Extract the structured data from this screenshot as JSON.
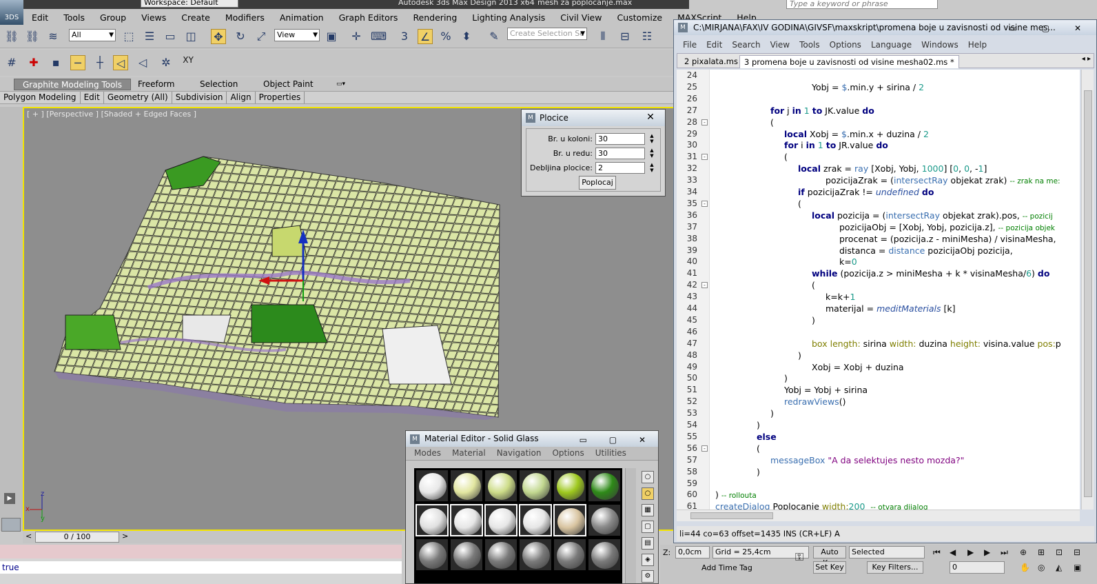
{
  "titlebar": {
    "app_logo": "3DS",
    "workspace": "Workspace: Default",
    "title": "Autodesk 3ds Max Design 2013 x64",
    "file": "mesh za poplocanje.max",
    "search_placeholder": "Type a keyword or phrase"
  },
  "menu": [
    "Edit",
    "Tools",
    "Group",
    "Views",
    "Create",
    "Modifiers",
    "Animation",
    "Graph Editors",
    "Rendering",
    "Lighting Analysis",
    "Civil View",
    "Customize",
    "MAXScript",
    "Help"
  ],
  "toolbar": {
    "filter_value": "All",
    "refcoord_value": "View",
    "selection_set_placeholder": "Create Selection Se"
  },
  "toolbar2": {
    "xy_label": "XY"
  },
  "ribbon": {
    "tabs": [
      "Graphite Modeling Tools",
      "Freeform",
      "Selection",
      "Object Paint"
    ],
    "sub": [
      "Polygon Modeling",
      "Edit",
      "Geometry (All)",
      "Subdivision",
      "Align",
      "Properties"
    ]
  },
  "viewport": {
    "label": "[ + ] [Perspective ] [Shaded + Edged Faces ]"
  },
  "dialog": {
    "title": "Plocice",
    "fields": [
      {
        "label": "Br. u koloni:",
        "value": "30"
      },
      {
        "label": "Br. u redu:",
        "value": "30"
      },
      {
        "label": "Debljina plocice:",
        "value": "2"
      }
    ],
    "button": "Poplocaj"
  },
  "material_editor": {
    "title": "Material Editor - Solid Glass",
    "menu": [
      "Modes",
      "Material",
      "Navigation",
      "Options",
      "Utilities"
    ],
    "row1_colors": [
      "#e8e8e8",
      "#e2e6a0",
      "#cddc88",
      "#c2d890",
      "#9ec81e",
      "#2e8a18"
    ],
    "row2_colors": [
      "#e0e0e0",
      "#e6e6e6",
      "#e6e6e6",
      "#e6e6e6",
      "#d8c4a0",
      "#8a8a8a"
    ],
    "row3_colors": [
      "#7a7a7a",
      "#7a7a7a",
      "#7a7a7a",
      "#7a7a7a",
      "#7a7a7a",
      "#7a7a7a"
    ]
  },
  "editor": {
    "title": "C:\\MIRJANA\\FAX\\IV GODINA\\GIVSF\\maxskript\\promena boje u zavisnosti od visine mes...",
    "menu": [
      "File",
      "Edit",
      "Search",
      "View",
      "Tools",
      "Options",
      "Language",
      "Windows",
      "Help"
    ],
    "tabs": [
      "2 pixalata.ms",
      "3 promena boje u zavisnosti od visine mesha02.ms *"
    ],
    "status": "li=44 co=63 offset=1435 INS (CR+LF) A",
    "lines": [
      {
        "n": "24",
        "indent": 0,
        "fold": "",
        "html": ""
      },
      {
        "n": "25",
        "indent": 140,
        "fold": "",
        "html": "Yobj = <span class='fn'>$</span>.min.y + sirina / <span class='num'>2</span>"
      },
      {
        "n": "26",
        "indent": 0,
        "fold": "",
        "html": ""
      },
      {
        "n": "27",
        "indent": 80,
        "fold": "",
        "html": "<span class='kw'>for</span> j <span class='kw'>in</span> <span class='num'>1</span> <span class='kw'>to</span> JK.value <span class='kw'>do</span>"
      },
      {
        "n": "28",
        "indent": 80,
        "fold": "-",
        "html": "("
      },
      {
        "n": "29",
        "indent": 100,
        "fold": "",
        "html": "<span class='kw'>local</span> Xobj = <span class='fn'>$</span>.min.x + duzina / <span class='num'>2</span>"
      },
      {
        "n": "30",
        "indent": 100,
        "fold": "",
        "html": "<span class='kw'>for</span> i <span class='kw'>in</span> <span class='num'>1</span> <span class='kw'>to</span> JR.value <span class='kw'>do</span>"
      },
      {
        "n": "31",
        "indent": 100,
        "fold": "-",
        "html": "("
      },
      {
        "n": "32",
        "indent": 120,
        "fold": "",
        "html": "<span class='kw'>local</span> zrak = <span class='fn'>ray</span> [Xobj, Yobj, <span class='num'>1000</span>] [<span class='num'>0</span>, <span class='num'>0</span>, -<span class='num'>1</span>]"
      },
      {
        "n": "33",
        "indent": 160,
        "fold": "",
        "html": "pozicijaZrak = (<span class='fn'>intersectRay</span> objekat zrak) <span class='cm'>-- zrak na me:</span>"
      },
      {
        "n": "34",
        "indent": 120,
        "fold": "",
        "html": "<span class='kw'>if</span> pozicijaZrak != <span class='it'>undefined</span> <span class='kw'>do</span>"
      },
      {
        "n": "35",
        "indent": 120,
        "fold": "-",
        "html": "("
      },
      {
        "n": "36",
        "indent": 140,
        "fold": "",
        "html": "<span class='kw'>local</span> pozicija = (<span class='fn'>intersectRay</span> objekat zrak).pos, <span class='cm'>-- pozicij</span>"
      },
      {
        "n": "37",
        "indent": 180,
        "fold": "",
        "html": "pozicijaObj = [Xobj, Yobj, pozicija.z], <span class='cm'>-- pozicija objek</span>"
      },
      {
        "n": "38",
        "indent": 180,
        "fold": "",
        "html": "procenat = (pozicija.z - miniMesha) / visinaMesha,"
      },
      {
        "n": "39",
        "indent": 180,
        "fold": "",
        "html": "distanca = <span class='fn'>distance</span> pozicijaObj pozicija,"
      },
      {
        "n": "40",
        "indent": 180,
        "fold": "",
        "html": "k=<span class='num'>0</span>"
      },
      {
        "n": "41",
        "indent": 140,
        "fold": "",
        "html": "<span class='kw'>while</span> (pozicija.z &gt; miniMesha + k * visinaMesha/<span class='num'>6</span>) <span class='kw'>do</span>"
      },
      {
        "n": "42",
        "indent": 140,
        "fold": "-",
        "html": "("
      },
      {
        "n": "43",
        "indent": 160,
        "fold": "",
        "html": "k=k+<span class='num'>1</span>"
      },
      {
        "n": "44",
        "indent": 160,
        "fold": "",
        "html": "materijal = <span class='it'>meditMaterials</span> [k]"
      },
      {
        "n": "45",
        "indent": 140,
        "fold": "",
        "html": ")"
      },
      {
        "n": "46",
        "indent": 0,
        "fold": "",
        "html": ""
      },
      {
        "n": "47",
        "indent": 140,
        "fold": "",
        "html": "<span class='prop'>box</span> <span class='prop'>length:</span> sirina <span class='prop'>width:</span> duzina <span class='prop'>height:</span> visina.value <span class='prop'>pos:</span>p"
      },
      {
        "n": "48",
        "indent": 120,
        "fold": "",
        "html": ")"
      },
      {
        "n": "49",
        "indent": 140,
        "fold": "",
        "html": "Xobj = Xobj + duzina"
      },
      {
        "n": "50",
        "indent": 100,
        "fold": "",
        "html": ")"
      },
      {
        "n": "51",
        "indent": 100,
        "fold": "",
        "html": "Yobj = Yobj + sirina"
      },
      {
        "n": "52",
        "indent": 100,
        "fold": "",
        "html": "<span class='fn'>redrawViews</span>()"
      },
      {
        "n": "53",
        "indent": 80,
        "fold": "",
        "html": ")"
      },
      {
        "n": "54",
        "indent": 60,
        "fold": "",
        "html": ")"
      },
      {
        "n": "55",
        "indent": 60,
        "fold": "",
        "html": "<span class='kw'>else</span>"
      },
      {
        "n": "56",
        "indent": 60,
        "fold": "-",
        "html": "("
      },
      {
        "n": "57",
        "indent": 80,
        "fold": "",
        "html": "<span class='fn'>messageBox</span> <span class='str'>\"A da selektujes nesto mozda?\"</span>"
      },
      {
        "n": "58",
        "indent": 60,
        "fold": "",
        "html": ")"
      },
      {
        "n": "59",
        "indent": 0,
        "fold": "",
        "html": ""
      },
      {
        "n": "60",
        "indent": 0,
        "fold": "",
        "html": ") <span class='cm'>-- rollouta</span>"
      },
      {
        "n": "61",
        "indent": 0,
        "fold": "",
        "html": "<span class='fn'>createDialog</span> Poplocanje <span class='prop'>width:</span><span class='num'>200</span>  <span class='cm'>-- otvara dijalog</span>"
      }
    ]
  },
  "timeslider": {
    "value": "0 / 100",
    "prev": "<",
    "next": ">"
  },
  "listener": {
    "output": "true"
  },
  "status": {
    "coord": "0,0cm",
    "grid": "Grid = 25,4cm",
    "auto_key": "Auto Key",
    "selected": "Selected",
    "set_key": "Set Key",
    "key_filters": "Key Filters...",
    "add_time_tag": "Add Time Tag",
    "frame": "0"
  },
  "viewport_axes": {
    "x": "x",
    "y": "y",
    "z": "z"
  }
}
